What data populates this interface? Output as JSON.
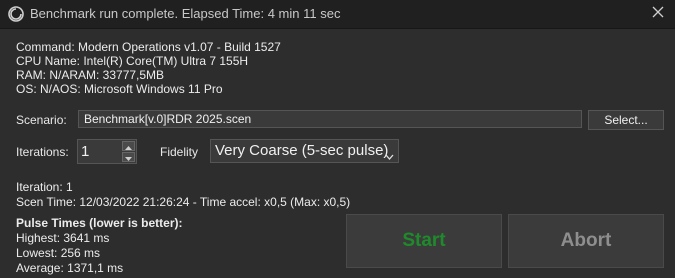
{
  "window": {
    "title": "Benchmark run complete. Elapsed Time: 4 min 11 sec",
    "app_icon": "app-logo-icon",
    "close_icon": "close-icon"
  },
  "system_info": {
    "command": "Command: Modern Operations v1.07 - Build 1527",
    "cpu": "CPU Name: Intel(R) Core(TM) Ultra 7 155H",
    "ram": "RAM: N/ARAM: 33777,5MB",
    "os": "OS: N/AOS: Microsoft Windows 11 Pro"
  },
  "scenario": {
    "label": "Scenario:",
    "value": "Benchmark[v.0]RDR 2025.scen",
    "select_label": "Select..."
  },
  "iterations": {
    "label": "Iterations:",
    "value": "1"
  },
  "fidelity": {
    "label": "Fidelity",
    "selected": "Very Coarse (5-sec pulse)"
  },
  "status": {
    "iteration": "Iteration: 1",
    "scen_time": "Scen Time: 12/03/2022 21:26:24 - Time accel: x0,5 (Max: x0,5)"
  },
  "pulse": {
    "header": "Pulse Times (lower is better):",
    "highest": "Highest: 3641 ms",
    "lowest": "Lowest: 256 ms",
    "average": "Average: 1371,1 ms"
  },
  "actions": {
    "start_label": "Start",
    "abort_label": "Abort"
  },
  "colors": {
    "background": "#2d2d2d",
    "titlebar": "#202020",
    "start_text": "#1f8a2b",
    "abort_text": "#8e8e8e"
  }
}
